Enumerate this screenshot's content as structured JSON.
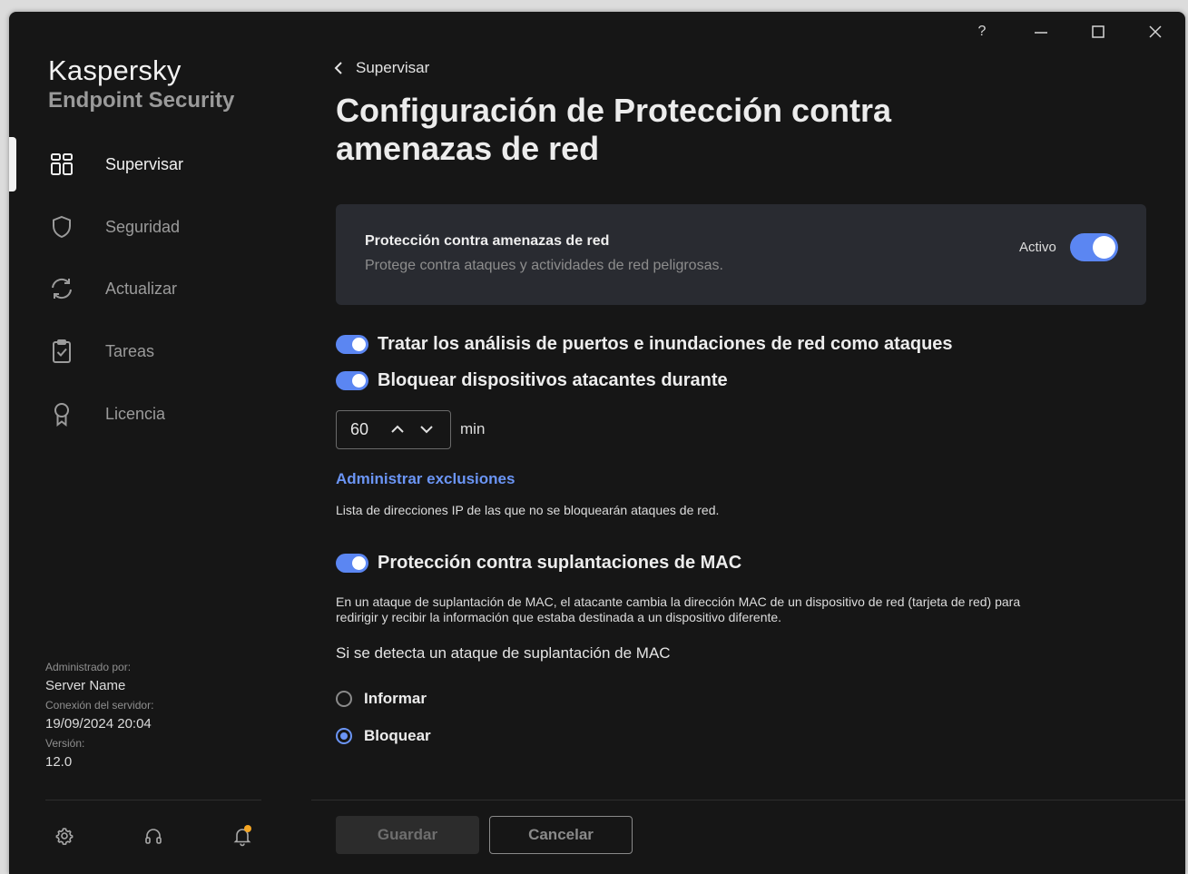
{
  "window": {
    "controls": {
      "help": "?",
      "minimize": "—",
      "maximize": "☐",
      "close": "✕"
    }
  },
  "sidebar": {
    "brand_line1": "Kaspersky",
    "brand_line2": "Endpoint Security",
    "items": [
      {
        "label": "Supervisar",
        "icon": "dashboard-icon",
        "active": true
      },
      {
        "label": "Seguridad",
        "icon": "shield-icon",
        "active": false
      },
      {
        "label": "Actualizar",
        "icon": "refresh-icon",
        "active": false
      },
      {
        "label": "Tareas",
        "icon": "clipboard-icon",
        "active": false
      },
      {
        "label": "Licencia",
        "icon": "award-icon",
        "active": false
      }
    ],
    "managed_by_label": "Administrado por:",
    "managed_by_value": "Server Name",
    "connection_label": "Conexión del servidor:",
    "connection_value": "19/09/2024 20:04",
    "version_label": "Versión:",
    "version_value": "12.0",
    "footer_icons": [
      "gear-icon",
      "headset-icon",
      "bell-icon"
    ],
    "notification_dot_color": "#f5a623"
  },
  "main": {
    "back_label": "Supervisar",
    "title": "Configuración de Protección contra amenazas de red",
    "card": {
      "title": "Protección contra amenazas de red",
      "subtitle": "Protege contra ataques y actividades de red peligrosas.",
      "state_label": "Activo",
      "enabled": true
    },
    "option_port_scan": {
      "label": "Tratar los análisis de puertos e inundaciones de red como ataques",
      "enabled": true
    },
    "option_block": {
      "label": "Bloquear dispositivos atacantes durante",
      "enabled": true
    },
    "block_duration": {
      "value": "60",
      "unit": "min"
    },
    "exclusions_link": "Administrar exclusiones",
    "exclusions_desc": "Lista de direcciones IP de las que no se bloquearán ataques de red.",
    "option_mac": {
      "label": "Protección contra suplantaciones de MAC",
      "enabled": true
    },
    "mac_desc_line1": "En un ataque de suplantación de MAC, el atacante cambia la dirección MAC de un dispositivo de red (tarjeta de red) para",
    "mac_desc_line2": "redirigir y recibir la información que estaba destinada a un dispositivo diferente.",
    "mac_question": "Si se detecta un ataque de suplantación de MAC",
    "mac_actions": [
      {
        "label": "Informar",
        "selected": false
      },
      {
        "label": "Bloquear",
        "selected": true
      }
    ],
    "save_label": "Guardar",
    "cancel_label": "Cancelar"
  },
  "colors": {
    "accent": "#5b86f2",
    "link": "#6b95f5",
    "background": "#161616",
    "card": "#292b31"
  }
}
